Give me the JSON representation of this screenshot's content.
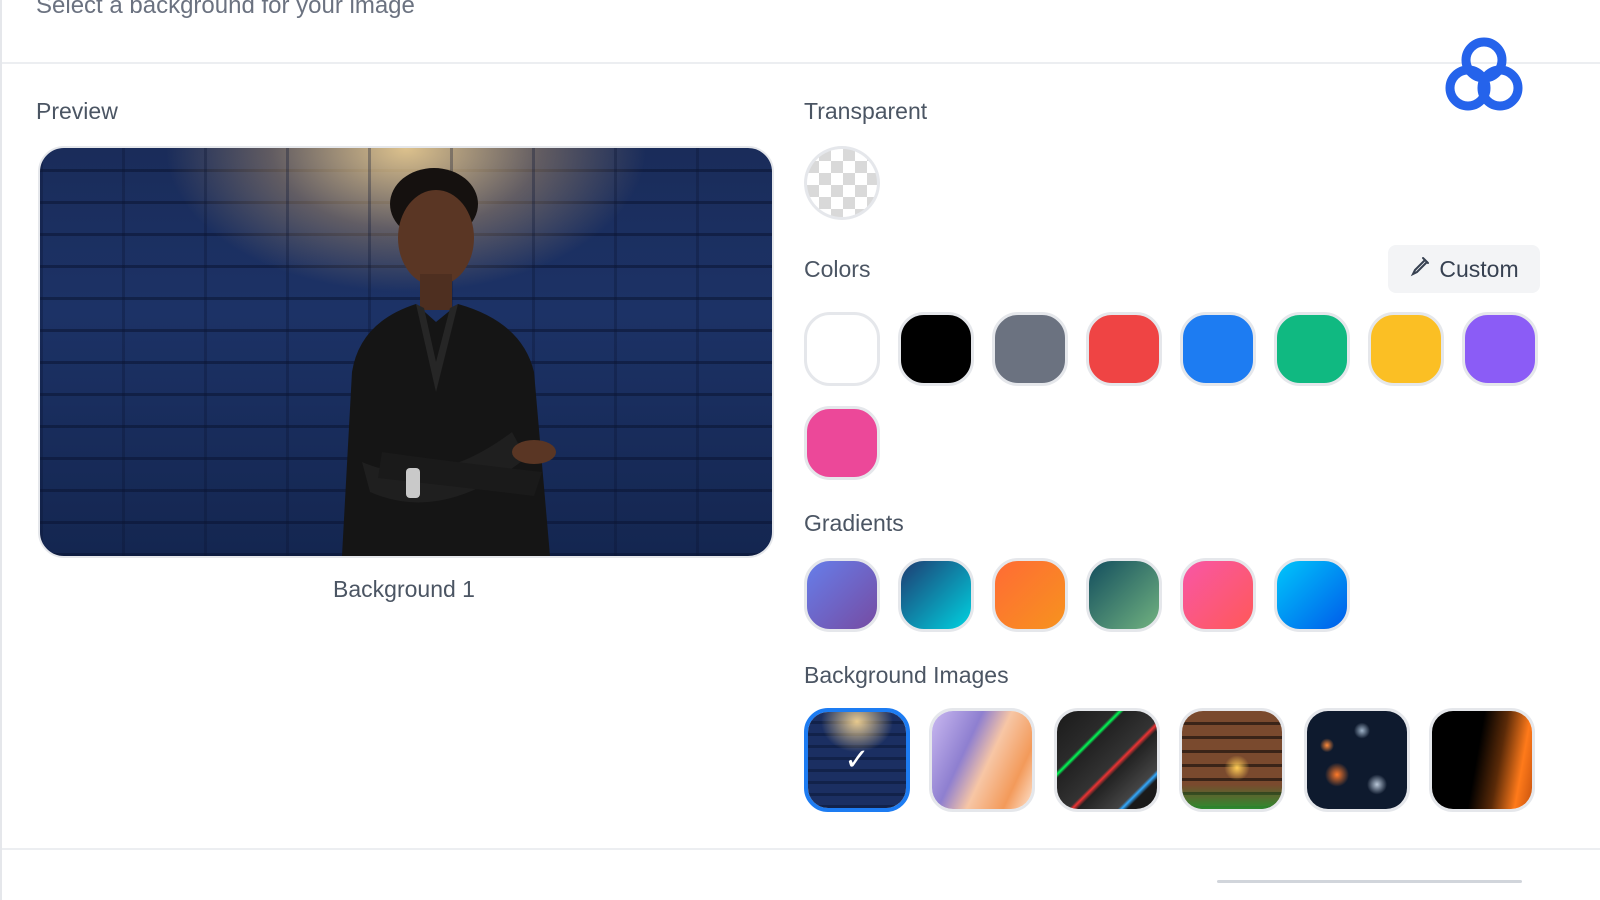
{
  "header": {
    "subtitle": "Select a background for your image"
  },
  "preview": {
    "label": "Preview",
    "caption": "Background 1"
  },
  "transparent": {
    "label": "Transparent"
  },
  "colors": {
    "label": "Colors",
    "custom_label": "Custom",
    "custom_icon": "eyedropper-icon",
    "swatches": [
      "#ffffff",
      "#000000",
      "#6b7280",
      "#ef4444",
      "#1d7cf2",
      "#10b981",
      "#fbbf24",
      "#8b5cf6",
      "#ec4899"
    ]
  },
  "gradients": {
    "label": "Gradients",
    "swatches": [
      [
        "#667eea",
        "#764ba2"
      ],
      [
        "#1e3c72",
        "#00d2e0"
      ],
      [
        "#ff6b35",
        "#f7931e"
      ],
      [
        "#134e5e",
        "#71b280"
      ],
      [
        "#f857a6",
        "#ff5858"
      ],
      [
        "#00c6fb",
        "#005bea"
      ]
    ]
  },
  "background_images": {
    "label": "Background Images",
    "items": [
      "brick-wall-spotlight",
      "abstract-paper-fold",
      "neon-geometric-stone",
      "brick-wall-lightbulbs",
      "floating-spheres",
      "orange-particles"
    ],
    "selected_index": 0
  },
  "accent_color": "#1d7cf2",
  "logo_icon": "brand-logo-icon"
}
